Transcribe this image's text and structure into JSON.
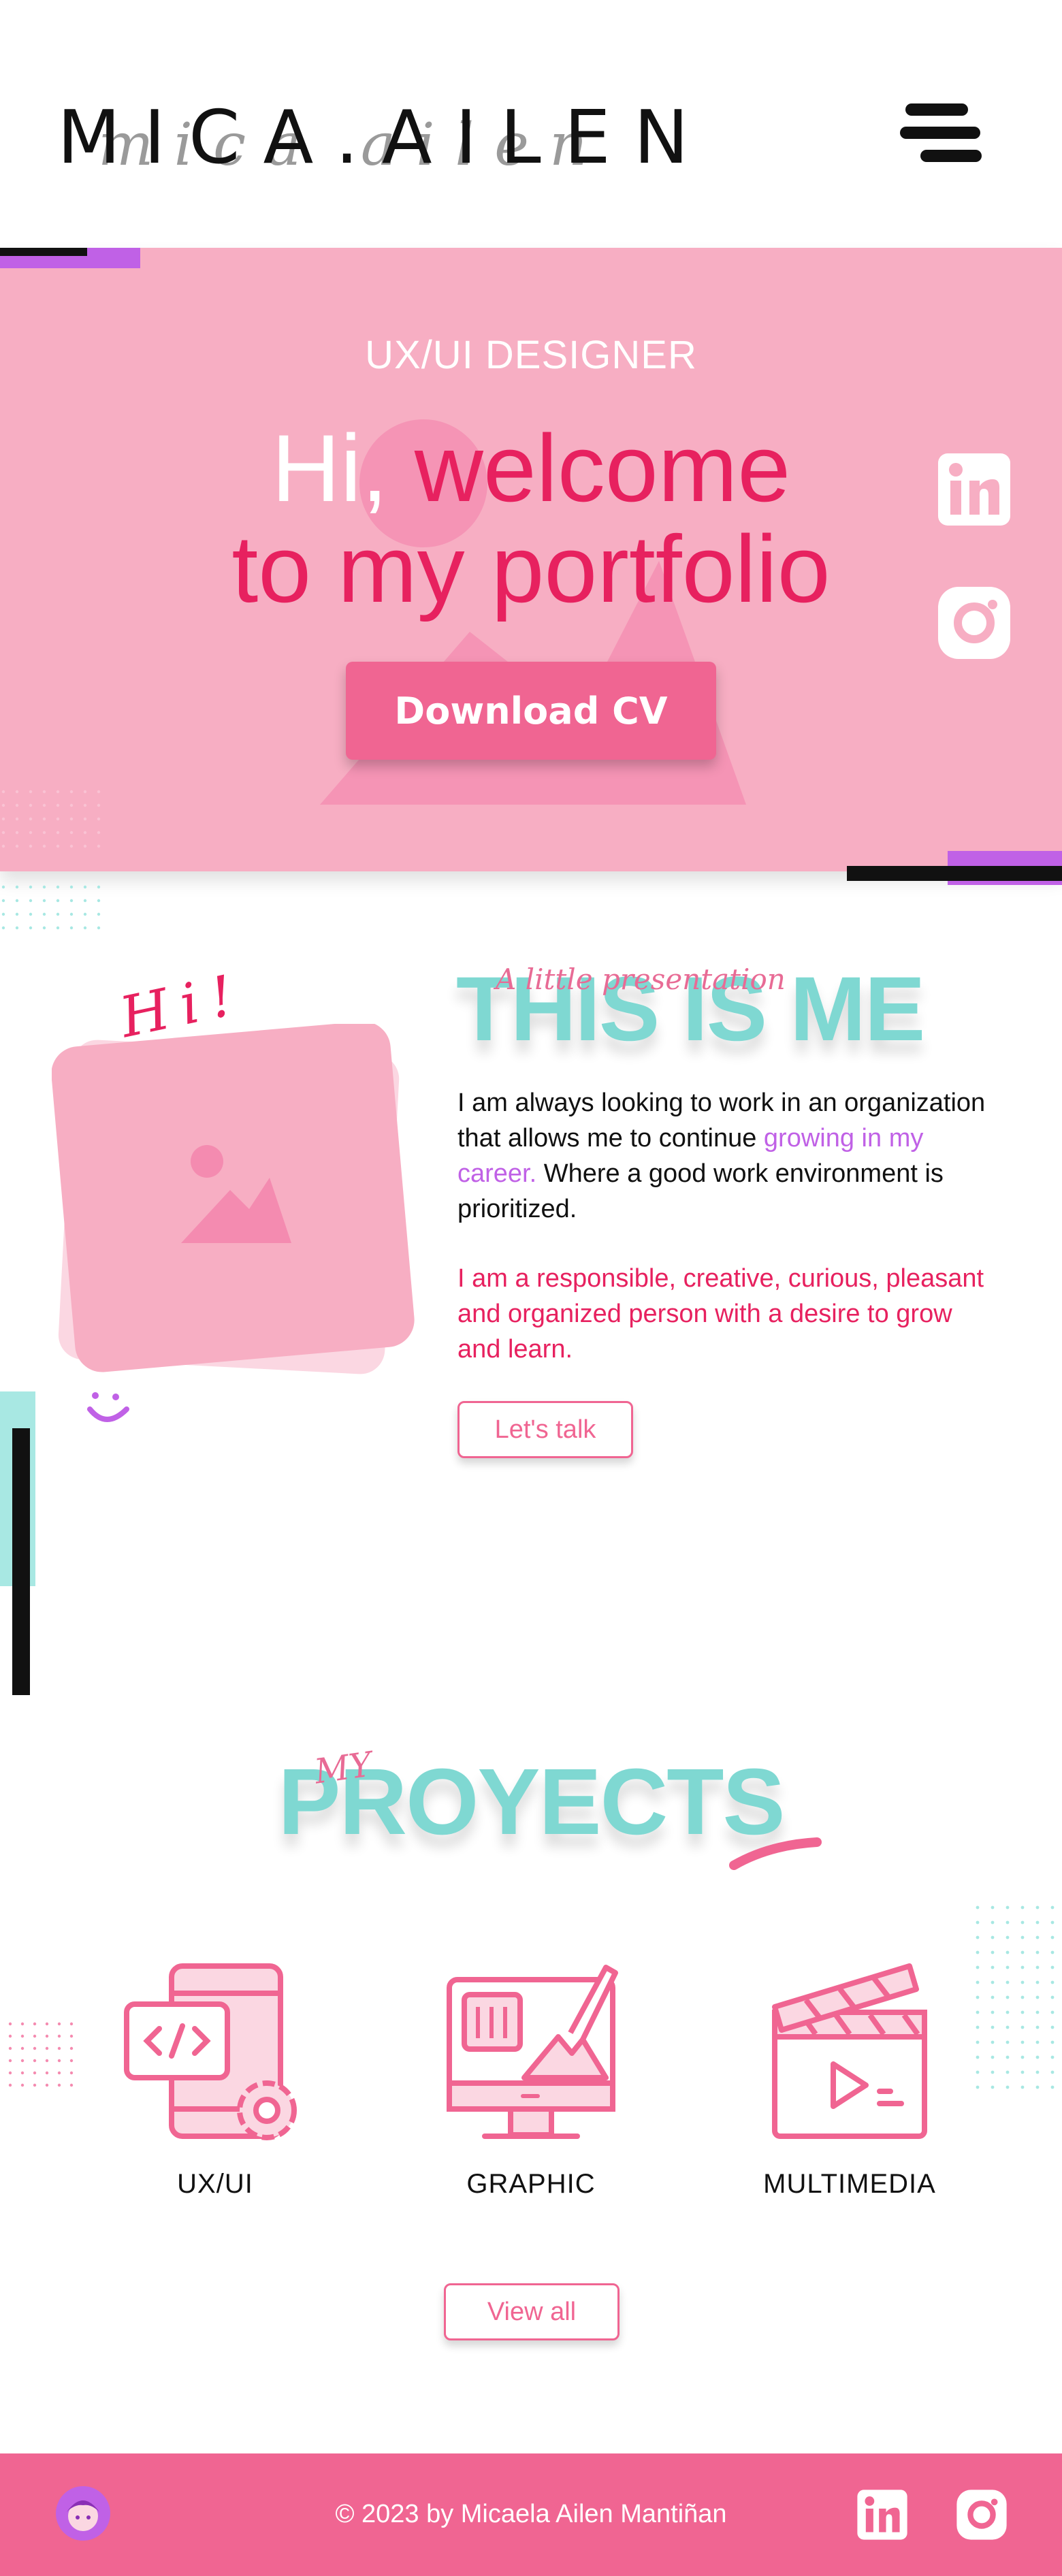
{
  "header": {
    "logo_text": "MICA.AILEN",
    "logo_script": "mica ailen"
  },
  "hero": {
    "role": "UX/UI DESIGNER",
    "title_hi": "Hi,",
    "title_rest": " welcome",
    "title_line2": "to my portfolio",
    "cta_label": "Download CV"
  },
  "about": {
    "hi_script": "Hi!",
    "subtitle": "A little presentation",
    "title": "THIS IS ME",
    "p1_before": "I am always looking to work in an organization that allows me to continue ",
    "p1_highlight": "growing in my career.",
    "p1_after": " Where a good work environment is prioritized.",
    "p2": "I am a responsible, creative, curious, pleasant and organized person with a desire to grow and learn.",
    "cta_label": "Let's talk"
  },
  "projects": {
    "subtitle": "MY",
    "title": "PROYECTS",
    "items": [
      {
        "label": "UX/UI",
        "icon": "mobile-code-gear-icon"
      },
      {
        "label": "GRAPHIC",
        "icon": "monitor-paintbrush-icon"
      },
      {
        "label": "MULTIMEDIA",
        "icon": "clapperboard-icon"
      }
    ],
    "cta_label": "View all"
  },
  "footer": {
    "copyright": "© 2023 by Micaela Ailen Mantiñan"
  },
  "colors": {
    "hero_bg": "#f7aec3",
    "accent_pink": "#f06592",
    "title_pink": "#e7215f",
    "teal": "#7fd8d2",
    "purple": "#c061e6"
  }
}
